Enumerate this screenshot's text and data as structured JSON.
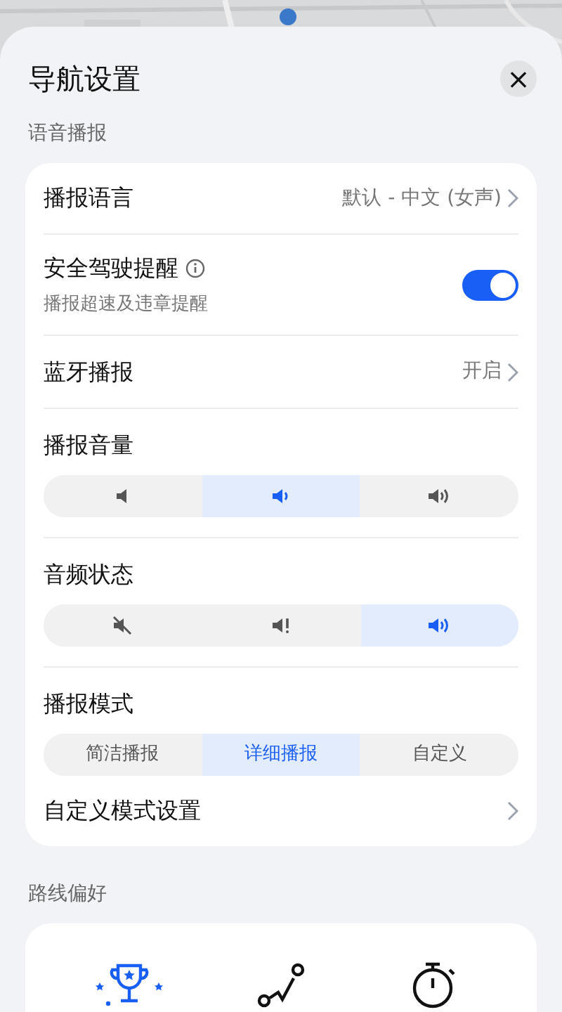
{
  "sheet": {
    "title": "导航设置",
    "close_label": "×"
  },
  "voice_section": {
    "label": "语音播报",
    "language": {
      "label": "播报语言",
      "value": "默认 - 中文 (女声)"
    },
    "safety": {
      "label": "安全驾驶提醒",
      "description": "播报超速及违章提醒",
      "on": true
    },
    "bluetooth": {
      "label": "蓝牙播报",
      "value": "开启"
    },
    "volume": {
      "label": "播报音量",
      "options": [
        {
          "kind": "low",
          "selected": false
        },
        {
          "kind": "medium",
          "selected": true
        },
        {
          "kind": "high",
          "selected": false
        }
      ]
    },
    "audio_state": {
      "label": "音频状态",
      "options": [
        {
          "kind": "mute",
          "selected": false
        },
        {
          "kind": "alert",
          "selected": false
        },
        {
          "kind": "sound",
          "selected": true
        }
      ]
    },
    "mode": {
      "label": "播报模式",
      "options": [
        {
          "label": "简洁播报",
          "selected": false
        },
        {
          "label": "详细播报",
          "selected": true
        },
        {
          "label": "自定义",
          "selected": false
        }
      ]
    },
    "custom": {
      "label": "自定义模式设置"
    }
  },
  "route_section": {
    "label": "路线偏好",
    "options": [
      {
        "kind": "trophy",
        "selected": true
      },
      {
        "kind": "route",
        "selected": false
      },
      {
        "kind": "stopwatch",
        "selected": false
      }
    ]
  }
}
